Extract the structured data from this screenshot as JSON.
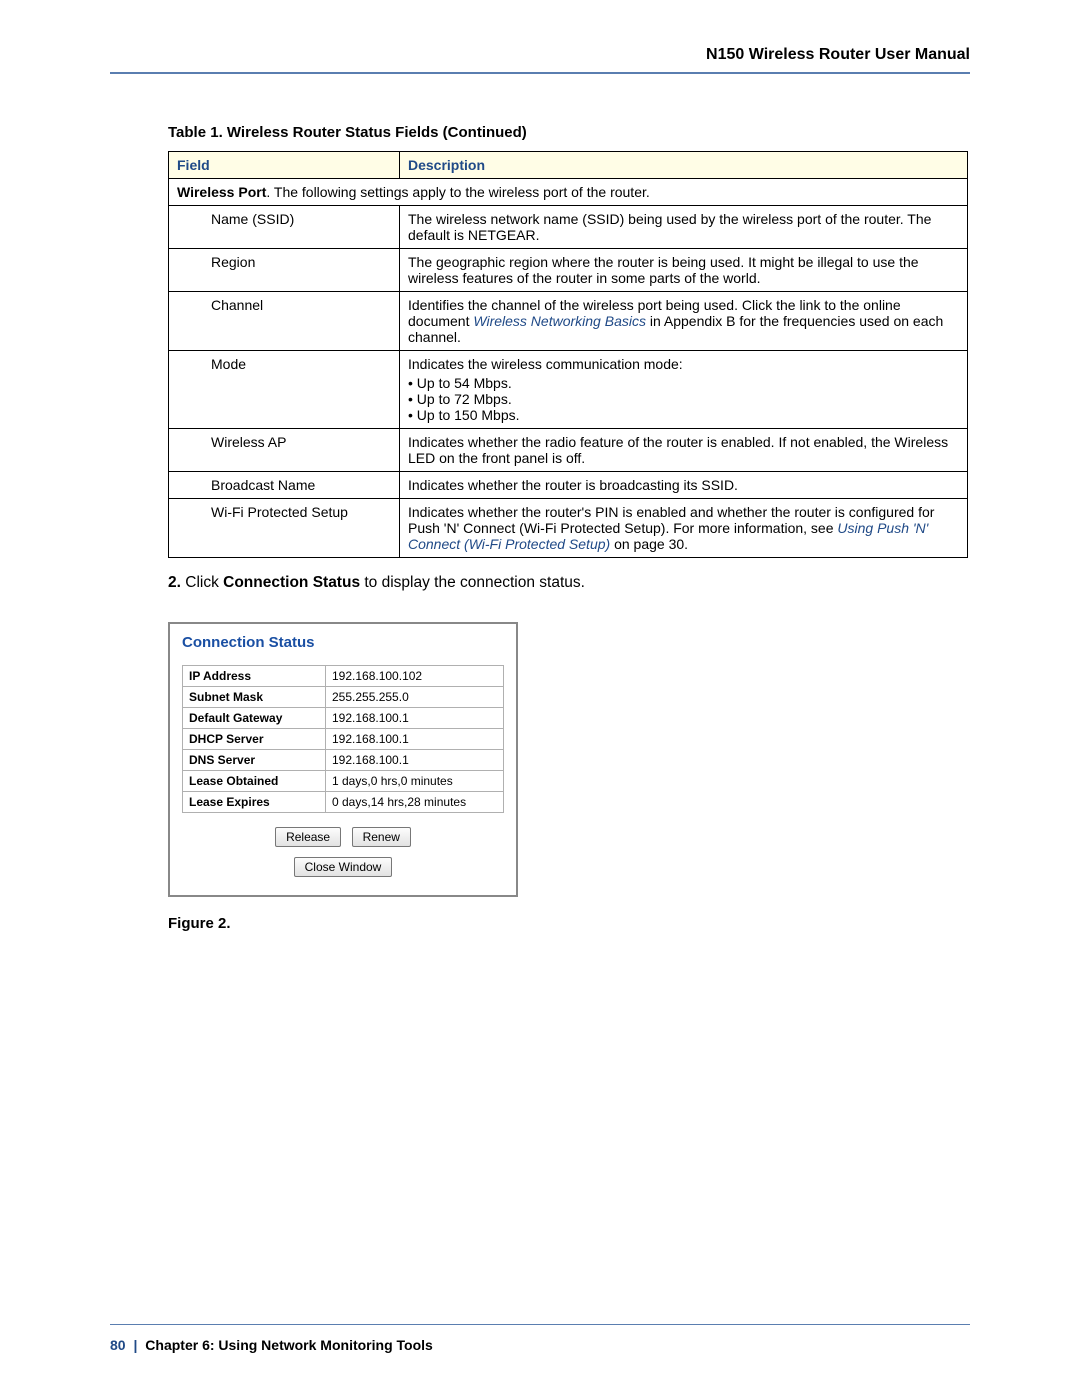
{
  "header": {
    "title": "N150 Wireless Router User Manual"
  },
  "table": {
    "caption": "Table 1.  Wireless Router Status Fields (Continued)",
    "head": {
      "field": "Field",
      "description": "Description"
    },
    "section_prefix_bold": "Wireless Port",
    "section_rest": ". The following settings apply to the wireless port of the router.",
    "rows": [
      {
        "field": "Name (SSID)",
        "desc": "The wireless network name (SSID) being used by the wireless port of the router. The default is NETGEAR."
      },
      {
        "field": "Region",
        "desc": "The geographic region where the router is being used. It might be illegal to use the wireless features of the router in some parts of the world."
      },
      {
        "field": "Channel",
        "desc_pre": "Identifies the channel of the wireless port being used. Click the link to the online document ",
        "desc_link": "Wireless Networking Basics",
        "desc_post": " in Appendix B for the frequencies used on each channel."
      },
      {
        "field": "Mode",
        "desc_intro": "Indicates the wireless communication mode:",
        "bullets": [
          "Up to 54 Mbps.",
          "Up to 72 Mbps.",
          "Up to 150 Mbps."
        ]
      },
      {
        "field": "Wireless AP",
        "desc": "Indicates whether the radio feature of the router is enabled. If not enabled, the Wireless LED on the front panel is off."
      },
      {
        "field": "Broadcast Name",
        "desc": "Indicates whether the router is broadcasting its SSID."
      },
      {
        "field": "Wi-Fi Protected Setup",
        "desc_pre": "Indicates whether the router's PIN is enabled and whether the router is configured for Push 'N' Connect (Wi-Fi Protected Setup). For more information, see ",
        "desc_link": "Using Push 'N' Connect (Wi-Fi Protected Setup)",
        "desc_post": " on page 30."
      }
    ]
  },
  "step": {
    "num": "2.",
    "pre": "Click ",
    "bold": "Connection Status",
    "post": " to display the connection status."
  },
  "conn": {
    "title": "Connection Status",
    "rows": [
      {
        "k": "IP Address",
        "v": "192.168.100.102"
      },
      {
        "k": "Subnet Mask",
        "v": "255.255.255.0"
      },
      {
        "k": "Default Gateway",
        "v": "192.168.100.1"
      },
      {
        "k": "DHCP Server",
        "v": "192.168.100.1"
      },
      {
        "k": "DNS Server",
        "v": "192.168.100.1"
      },
      {
        "k": "Lease Obtained",
        "v": "1 days,0 hrs,0 minutes"
      },
      {
        "k": "Lease Expires",
        "v": "0 days,14 hrs,28 minutes"
      }
    ],
    "buttons": {
      "release": "Release",
      "renew": "Renew",
      "close": "Close Window"
    }
  },
  "figure_caption": "Figure 2.  ",
  "footer": {
    "page": "80",
    "sep": "|",
    "chapter": "Chapter 6:  Using Network Monitoring Tools"
  }
}
